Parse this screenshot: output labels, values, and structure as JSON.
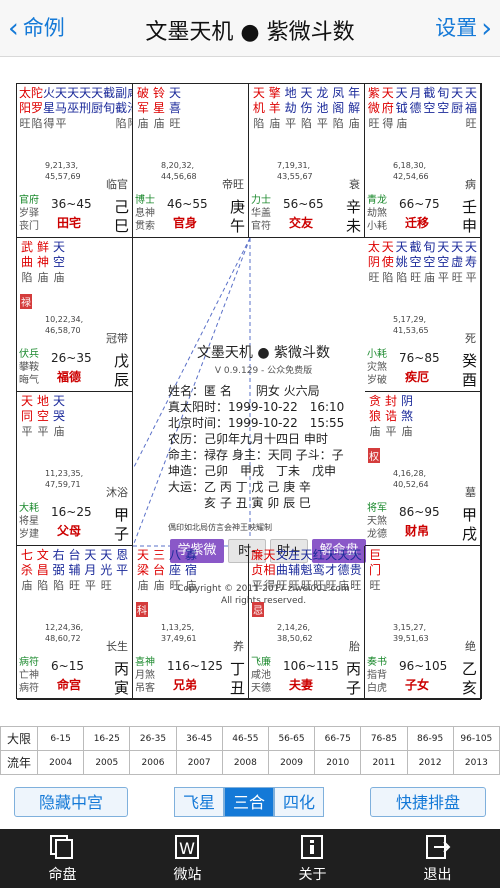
{
  "nav": {
    "back_label": "命例",
    "title": "文墨天机 ● 紫微斗数",
    "settings_label": "设置"
  },
  "palaces": [
    {
      "stars": [
        [
          "太",
          "阳",
          "旺"
        ],
        [
          "陀",
          "罗",
          "陷"
        ],
        [
          "火",
          "星",
          "得"
        ],
        [
          "天",
          "马",
          "平"
        ],
        [
          "天",
          "巫",
          ""
        ],
        [
          "天",
          "刑",
          ""
        ],
        [
          "天",
          "厨",
          ""
        ],
        [
          "截",
          "旬",
          ""
        ],
        [
          "副",
          "截",
          "陷"
        ],
        [
          "咸",
          "池",
          "陷"
        ]
      ],
      "ages": [
        "9,21,33,",
        "45,57,69"
      ],
      "life": "临官",
      "minor": [
        [
          "官府",
          "g"
        ],
        [
          "岁驿",
          ""
        ],
        [
          "丧门",
          ""
        ]
      ],
      "range": "36~45",
      "palace": "田宅",
      "stem": "己巳"
    },
    {
      "stars": [
        [
          "破",
          "军",
          "庙"
        ],
        [
          "铃",
          "星",
          "庙"
        ],
        [
          "天",
          "喜",
          "旺"
        ]
      ],
      "ages": [
        "8,20,32,",
        "44,56,68"
      ],
      "life": "帝旺",
      "minor": [
        [
          "博士",
          "g"
        ],
        [
          "息神",
          ""
        ],
        [
          "贯索",
          ""
        ]
      ],
      "range": "46~55",
      "palace": "官身",
      "stem": "庚午"
    },
    {
      "stars": [
        [
          "天",
          "机",
          "陷"
        ],
        [
          "擎",
          "羊",
          "庙"
        ],
        [
          "地",
          "劫",
          "平"
        ],
        [
          "天",
          "伤",
          "陷"
        ],
        [
          "龙",
          "池",
          "平"
        ],
        [
          "凤",
          "阁",
          "陷"
        ],
        [
          "年",
          "解",
          "庙"
        ]
      ],
      "ages": [
        "7,19,31,",
        "43,55,67"
      ],
      "life": "衰",
      "minor": [
        [
          "力士",
          "g"
        ],
        [
          "华盖",
          ""
        ],
        [
          "官符",
          ""
        ]
      ],
      "range": "56~65",
      "palace": "交友",
      "stem": "辛未"
    },
    {
      "stars": [
        [
          "紫",
          "微",
          "旺"
        ],
        [
          "天",
          "府",
          "得"
        ],
        [
          "天",
          "钺",
          "庙"
        ],
        [
          "月",
          "德",
          ""
        ],
        [
          "截",
          "空",
          ""
        ],
        [
          "旬",
          "空",
          ""
        ],
        [
          "天",
          "厨",
          ""
        ],
        [
          "天",
          "福",
          "旺"
        ]
      ],
      "ages": [
        "6,18,30,",
        "42,54,66"
      ],
      "life": "病",
      "minor": [
        [
          "青龙",
          "g"
        ],
        [
          "劫煞",
          ""
        ],
        [
          "小耗",
          ""
        ]
      ],
      "range": "66~75",
      "palace": "迁移",
      "stem": "壬申"
    },
    {
      "stars": [
        [
          "武",
          "曲",
          "陷"
        ],
        [
          "鲜",
          "神",
          "庙"
        ],
        [
          "天",
          "空",
          "庙"
        ]
      ],
      "hua": "禄",
      "ages": [
        "10,22,34,",
        "46,58,70"
      ],
      "life": "冠带",
      "minor": [
        [
          "伏兵",
          "g"
        ],
        [
          "攀鞍",
          ""
        ],
        [
          "晦气",
          ""
        ]
      ],
      "range": "26~35",
      "palace": "福德",
      "stem": "戊辰"
    },
    {
      "stars": [
        [
          "太",
          "阴",
          "旺"
        ],
        [
          "天",
          "使",
          "陷"
        ],
        [
          "天",
          "姚",
          "陷"
        ],
        [
          "截",
          "空",
          "旺"
        ],
        [
          "旬",
          "空",
          "庙"
        ],
        [
          "天",
          "空",
          "平"
        ],
        [
          "天",
          "虚",
          "旺"
        ],
        [
          "天",
          "寿",
          "平"
        ]
      ],
      "ages": [
        "5,17,29,",
        "41,53,65"
      ],
      "life": "死",
      "minor": [
        [
          "小耗",
          "g"
        ],
        [
          "灾煞",
          ""
        ],
        [
          "岁破",
          ""
        ]
      ],
      "range": "76~85",
      "palace": "疾厄",
      "stem": "癸酉"
    },
    {
      "stars": [
        [
          "天",
          "同",
          "平"
        ],
        [
          "地",
          "空",
          "平"
        ],
        [
          "天",
          "哭",
          "庙"
        ]
      ],
      "ages": [
        "11,23,35,",
        "47,59,71"
      ],
      "life": "沐浴",
      "minor": [
        [
          "大耗",
          "g"
        ],
        [
          "将星",
          ""
        ],
        [
          "岁建",
          ""
        ]
      ],
      "range": "16~25",
      "palace": "父母",
      "stem": "甲子"
    },
    {
      "stars": [
        [
          "贪",
          "狼",
          "庙"
        ],
        [
          "封",
          "诰",
          "平"
        ],
        [
          "阴",
          "煞",
          "庙"
        ]
      ],
      "hua": "权",
      "ages": [
        "4,16,28,",
        "40,52,64"
      ],
      "life": "墓",
      "minor": [
        [
          "将军",
          "g"
        ],
        [
          "天煞",
          ""
        ],
        [
          "龙德",
          ""
        ]
      ],
      "range": "86~95",
      "palace": "财帛",
      "stem": "甲戌"
    },
    {
      "stars": [
        [
          "七",
          "杀",
          "庙"
        ],
        [
          "文",
          "昌",
          "陷"
        ],
        [
          "右",
          "弼",
          "陷"
        ],
        [
          "台",
          "辅",
          "旺"
        ],
        [
          "天",
          "月",
          "平"
        ],
        [
          "天",
          "光",
          "旺"
        ],
        [
          "恩",
          "平",
          ""
        ]
      ],
      "ages": [
        "12,24,36,",
        "48,60,72"
      ],
      "life": "长生",
      "minor": [
        [
          "病符",
          "g"
        ],
        [
          "亡神",
          ""
        ],
        [
          "病符",
          ""
        ]
      ],
      "range": "6~15",
      "palace": "命宫",
      "stem": "丙寅"
    },
    {
      "stars": [
        [
          "天",
          "梁",
          "庙"
        ],
        [
          "三",
          "台",
          "庙"
        ],
        [
          "八",
          "座",
          "旺"
        ],
        [
          "寡",
          "宿",
          "庙"
        ]
      ],
      "hua": "科",
      "ages": [
        "1,13,25,",
        "37,49,61"
      ],
      "life": "养",
      "minor": [
        [
          "喜神",
          "g"
        ],
        [
          "月煞",
          ""
        ],
        [
          "吊客",
          ""
        ]
      ],
      "range": "116~125",
      "palace": "兄弟",
      "stem": "丁丑"
    },
    {
      "stars": [
        [
          "廉",
          "贞",
          "平"
        ],
        [
          "天",
          "相",
          "得"
        ],
        [
          "文",
          "曲",
          "旺"
        ],
        [
          "左",
          "辅",
          "旺"
        ],
        [
          "天",
          "魁",
          "旺"
        ],
        [
          "红",
          "鸾",
          "旺"
        ],
        [
          "天",
          "才",
          "旺"
        ],
        [
          "天",
          "德",
          "庙"
        ],
        [
          "天",
          "贵",
          "旺"
        ]
      ],
      "hua": "忌",
      "ages": [
        "2,14,26,",
        "38,50,62"
      ],
      "life": "胎",
      "minor": [
        [
          "飞廉",
          "g"
        ],
        [
          "咸池",
          ""
        ],
        [
          "天德",
          ""
        ]
      ],
      "range": "106~115",
      "palace": "夫妻",
      "stem": "丙子"
    },
    {
      "stars": [
        [
          "巨",
          "门",
          "旺"
        ]
      ],
      "ages": [
        "3,15,27,",
        "39,51,63"
      ],
      "life": "绝",
      "minor": [
        [
          "奏书",
          "g"
        ],
        [
          "指背",
          ""
        ],
        [
          "白虎",
          ""
        ]
      ],
      "range": "96~105",
      "palace": "子女",
      "stem": "乙亥"
    }
  ],
  "center": {
    "title": "文墨天机 ● 紫微斗数",
    "version": "V 0.9.129 - 公众免费版",
    "info": [
      "姓名：匿 名　　阴女 火六局",
      "真太阳时：1999-10-22　16:10",
      "北京时间：1999-10-22　15:55",
      "农历：己卯年九月十四日 申时",
      "命主：禄存 身主：天同 子斗：子",
      "坤造：己卯　甲戌　丁未　戊申",
      "大运：乙 丙 丁 戊 己 庚 辛",
      "　　　亥 子 丑 寅 卯 辰 巳"
    ],
    "watermark": "偶印如北局仿言会神王映耀制",
    "buttons": {
      "b1": "学紫微",
      "b2": "时-",
      "b3": "时+",
      "b4": "解命盘"
    },
    "copyright": "Copyright © 2011-2017 ziwei001.com",
    "rights": "All rights reserved."
  },
  "table": {
    "row1_label": "大限",
    "row2_label": "流年",
    "ranges": [
      "6-15",
      "16-25",
      "26-35",
      "36-45",
      "46-55",
      "56-65",
      "66-75",
      "76-85",
      "86-95",
      "96-105"
    ],
    "years": [
      "2004",
      "2005",
      "2006",
      "2007",
      "2008",
      "2009",
      "2010",
      "2011",
      "2012",
      "2013"
    ]
  },
  "controls": {
    "hide": "隐藏中宫",
    "tab1": "飞星",
    "tab2": "三合",
    "tab3": "四化",
    "quick": "快捷排盘",
    "active_tab": "三合"
  },
  "tabbar": [
    {
      "label": "命盘",
      "icon": "chart-icon"
    },
    {
      "label": "微站",
      "icon": "w-icon"
    },
    {
      "label": "关于",
      "icon": "info-icon"
    },
    {
      "label": "退出",
      "icon": "exit-icon"
    }
  ],
  "colors": {
    "accent": "#1479d7",
    "major_star": "#d00000",
    "minor_star": "#1b2a9a",
    "palace_name": "#c00000",
    "purple_button": "#8a58c8",
    "hua_badge": "#d43c3c",
    "tabbar": "#1f1f1f"
  }
}
